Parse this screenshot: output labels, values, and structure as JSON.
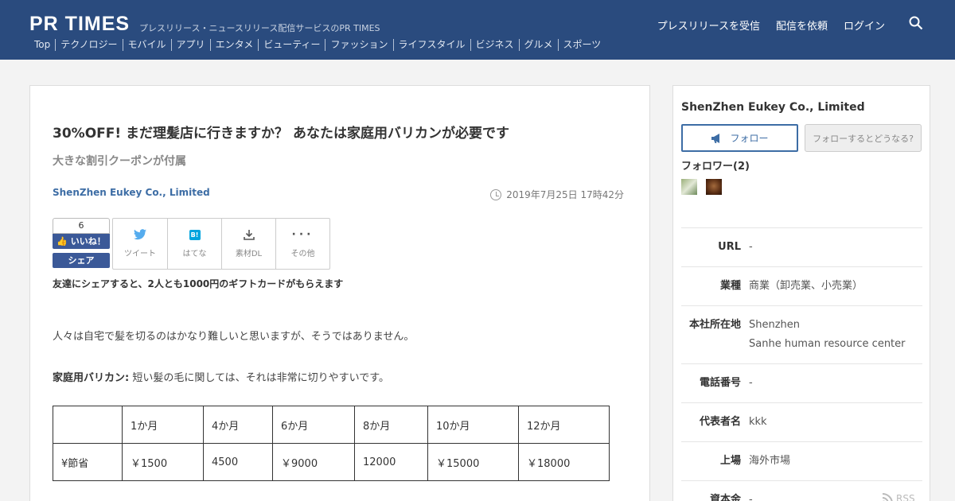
{
  "header": {
    "logo": "PR TIMES",
    "tagline": "プレスリリース・ニュースリリース配信サービスのPR TIMES",
    "nav": [
      "プレスリリースを受信",
      "配信を依頼",
      "ログイン"
    ],
    "categories": [
      "Top",
      "テクノロジー",
      "モバイル",
      "アプリ",
      "エンタメ",
      "ビューティー",
      "ファッション",
      "ライフスタイル",
      "ビジネス",
      "グルメ",
      "スポーツ"
    ]
  },
  "article": {
    "title": "30%OFF! まだ理髪店に行きますか？ あなたは家庭用バリカンが必要です",
    "subtitle": "大きな割引クーポンが付属",
    "company": "ShenZhen Eukey Co., Limited",
    "date": "2019年7月25日 17時42分",
    "like_count": "6",
    "like_label": "いいね！",
    "share_label": "シェア",
    "share_items": [
      "ツイート",
      "はてな",
      "素材DL",
      "その他"
    ],
    "gift_text": "友達にシェアすると、2人とも1000円のギフトカードがもらえます",
    "para1": "人々は自宅で髪を切るのはかなり難しいと思いますが、そうではありません。",
    "para2_bold": "家庭用バリカン:",
    "para2_text": " 短い髪の毛に関しては、それは非常に切りやすいです。",
    "table": {
      "header": [
        "",
        "1か月",
        "4か月",
        "6か月",
        "8か月",
        "10か月",
        "12か月"
      ],
      "row": [
        "¥節省",
        "￥1500",
        "4500",
        "￥9000",
        "12000",
        "￥15000",
        "￥18000"
      ]
    }
  },
  "sidebar": {
    "company": "ShenZhen Eukey Co., Limited",
    "follow_label": "フォロー",
    "what_label": "フォローするとどうなる?",
    "followers_label": "フォロワー(2)",
    "info": [
      {
        "k": "URL",
        "v": "-"
      },
      {
        "k": "業種",
        "v": "商業（卸売業、小売業）"
      },
      {
        "k": "本社所在地",
        "v": "Shenzhen",
        "v2": "Sanhe human resource center"
      },
      {
        "k": "電話番号",
        "v": "-"
      },
      {
        "k": "代表者名",
        "v": "kkk"
      },
      {
        "k": "上場",
        "v": "海外市場"
      },
      {
        "k": "資本金",
        "v": "-"
      }
    ],
    "rss": "RSS"
  }
}
